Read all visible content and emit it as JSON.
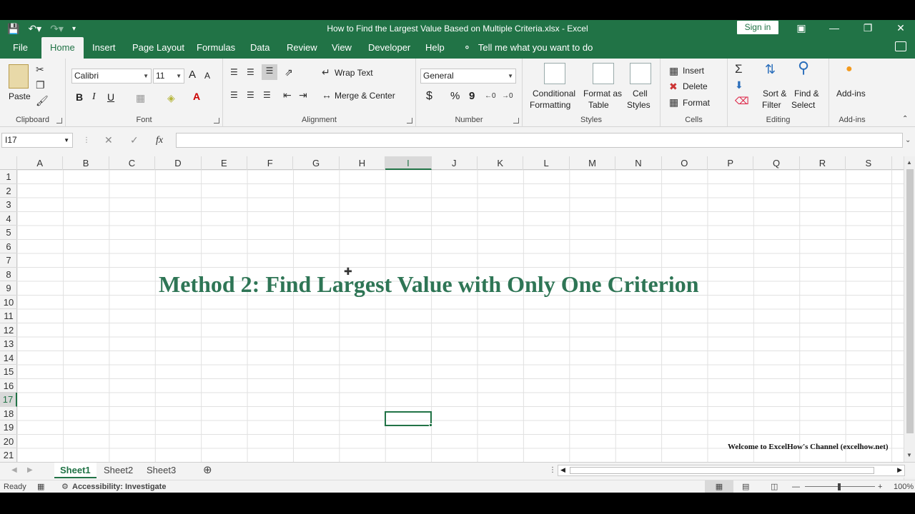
{
  "window": {
    "title": "How to Find the Largest Value Based on Multiple Criteria.xlsx  -  Excel",
    "signin_label": "Sign in"
  },
  "tabs": [
    "File",
    "Home",
    "Insert",
    "Page Layout",
    "Formulas",
    "Data",
    "Review",
    "View",
    "Developer",
    "Help"
  ],
  "tellme": "Tell me what you want to do",
  "ribbon": {
    "clipboard": {
      "paste": "Paste",
      "label": "Clipboard"
    },
    "font": {
      "name": "Calibri",
      "size": "11",
      "label": "Font",
      "bold": "B",
      "italic": "I",
      "underline": "U",
      "grow": "A",
      "shrink": "A"
    },
    "alignment": {
      "wrap": "Wrap Text",
      "merge": "Merge & Center",
      "label": "Alignment"
    },
    "number": {
      "format": "General",
      "label": "Number",
      "currency": "$",
      "percent": "%",
      "comma": "9"
    },
    "styles": {
      "conditional_1": "Conditional",
      "conditional_2": "Formatting",
      "format_table_1": "Format as",
      "format_table_2": "Table",
      "cell_styles_1": "Cell",
      "cell_styles_2": "Styles",
      "label": "Styles"
    },
    "cells": {
      "insert": "Insert",
      "delete": "Delete",
      "format": "Format",
      "label": "Cells"
    },
    "editing": {
      "sort_1": "Sort &",
      "sort_2": "Filter",
      "find_1": "Find &",
      "find_2": "Select",
      "label": "Editing"
    },
    "addins": {
      "button": "Add-ins",
      "label": "Add-ins"
    }
  },
  "formula_bar": {
    "name_box": "I17",
    "formula": ""
  },
  "grid": {
    "columns": [
      "A",
      "B",
      "C",
      "D",
      "E",
      "F",
      "G",
      "H",
      "I",
      "J",
      "K",
      "L",
      "M",
      "N",
      "O",
      "P",
      "Q",
      "R",
      "S"
    ],
    "rows": [
      "1",
      "2",
      "3",
      "4",
      "5",
      "6",
      "7",
      "8",
      "9",
      "10",
      "11",
      "12",
      "13",
      "14",
      "15",
      "16",
      "17",
      "18",
      "19",
      "20",
      "21"
    ],
    "selected_column": "I",
    "selected_row": "17",
    "heading": "Method 2: Find Largest Value with Only One Criterion",
    "welcome": "Welcome to ExcelHow's  Channel (excelhow.net)"
  },
  "sheets": [
    "Sheet1",
    "Sheet2",
    "Sheet3"
  ],
  "active_sheet": "Sheet1",
  "status": {
    "ready": "Ready",
    "accessibility": "Accessibility: Investigate",
    "zoom": "100%"
  },
  "colors": {
    "accent": "#217346",
    "heading": "#2e7555"
  }
}
